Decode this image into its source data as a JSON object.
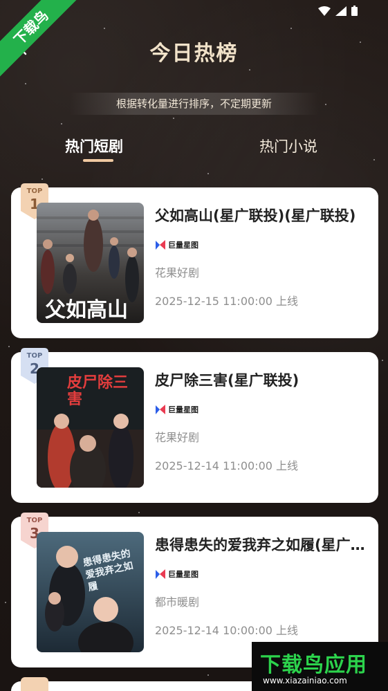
{
  "header": {
    "title": "今日热榜",
    "subtitle": "根据转化量进行排序，不定期更新"
  },
  "tabs": [
    {
      "label": "热门短剧",
      "active": true
    },
    {
      "label": "热门小说",
      "active": false
    }
  ],
  "items": [
    {
      "rank_label": "TOP",
      "rank": "1",
      "poster_text": "父如高山",
      "title": "父如高山(星广联投)(星广联投)",
      "brand": "巨量星图",
      "genre": "花果好剧",
      "date": "2025-12-15 11:00:00 上线",
      "badge_color": "#f0c9a1"
    },
    {
      "rank_label": "TOP",
      "rank": "2",
      "poster_text": "皮尸除三害",
      "title": "皮尸除三害(星广联投)",
      "brand": "巨量星图",
      "genre": "花果好剧",
      "date": "2025-12-14 11:00:00 上线",
      "badge_color": "#c9d6ee"
    },
    {
      "rank_label": "TOP",
      "rank": "3",
      "poster_text": "患得患失的爱我弃之如履",
      "title": "患得患失的爱我弃之如履(星广联投)",
      "brand": "巨量星图",
      "genre": "都市暖剧",
      "date": "2025-12-14 10:00:00 上线",
      "badge_color": "#f3c7c1"
    }
  ],
  "overlay": {
    "corner_text": "下载鸟",
    "watermark_main": "下载鸟应用",
    "watermark_url": "www.xiazainiao.com"
  }
}
